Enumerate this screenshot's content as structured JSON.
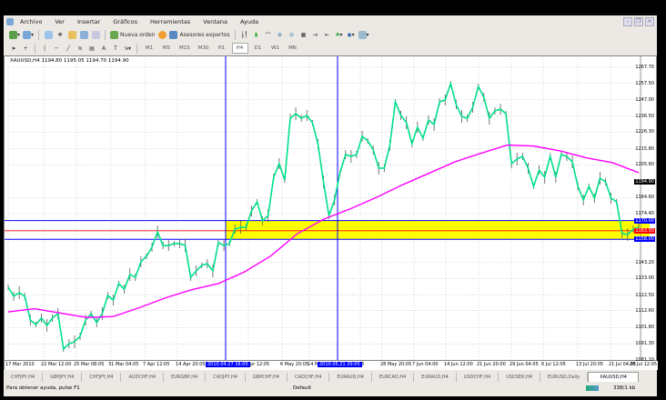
{
  "menu": [
    "Archivo",
    "Ver",
    "Insertar",
    "Gráficos",
    "Herramientas",
    "Ventana",
    "Ayuda"
  ],
  "toolbar": {
    "new_order": "Nueva orden",
    "experts": "Asesores expertos",
    "timeframes": [
      "M1",
      "M5",
      "M15",
      "M30",
      "H1",
      "H4",
      "D1",
      "W1",
      "MN"
    ],
    "active_timeframe": "H4"
  },
  "chart": {
    "header": "XAUUSD,H4  1194.80 1195.05 1194.70 1194.90",
    "colors": {
      "price": "#00e08a",
      "ma": "#ff00ff",
      "levels": "#0000ff",
      "mid_level": "#ff0000",
      "zone": "#ffff00",
      "bars": "#555555"
    }
  },
  "chart_data": {
    "type": "line",
    "symbol": "XAUUSD,H4",
    "ylim": [
      1081.1,
      1267.7
    ],
    "y_ticks": [
      "1267.70",
      "1257.50",
      "1247.00",
      "1236.50",
      "1226.30",
      "1215.80",
      "1205.60",
      "1184.60",
      "1174.40",
      "1143.20",
      "1133.00",
      "1122.50",
      "1112.60",
      "1101.80",
      "1091.30",
      "1081.10"
    ],
    "current_price": "1194.90",
    "levels": {
      "upper": "1170.00",
      "middle": "1163.50",
      "lower": "1158.00"
    },
    "x_ticks": [
      "17 Mar 2010",
      "22 Mar 12:00",
      "25 Mar 08:05",
      "31 Mar 04:05",
      "7 Apr 12:05",
      "14 Apr 20:05",
      "pr 12:05",
      "6 May 20:05",
      "14 May",
      "05",
      "28 May 20:05",
      "7 Jun 04:00",
      "14 Jun 12:00",
      "21 Jun 20:00",
      "29 Jun 04:05",
      "6 Jul 12:05",
      "13 Jul 20:05",
      "21 Jul 04:05",
      "28 Jul 12:05"
    ],
    "cursor_times": [
      "2010.04.27 16:05",
      "2010.05.21 20:05"
    ],
    "grid": true,
    "price": [
      1127.5,
      1121.7,
      1124.0,
      1121.7,
      1106.6,
      1103.7,
      1107.8,
      1103.1,
      1107.8,
      1110.7,
      1088.1,
      1091.5,
      1092.7,
      1096.2,
      1106.6,
      1110.7,
      1104.9,
      1110.7,
      1122.2,
      1119.3,
      1129.8,
      1126.3,
      1135.6,
      1133.8,
      1143.7,
      1147.2,
      1153.0,
      1162.8,
      1154.1,
      1154.1,
      1155.3,
      1155.3,
      1154.1,
      1133.8,
      1137.9,
      1141.4,
      1142.5,
      1137.9,
      1155.9,
      1154.1,
      1155.3,
      1164.5,
      1165.7,
      1165.7,
      1176.1,
      1181.9,
      1169.8,
      1173.2,
      1197.6,
      1206.3,
      1195.8,
      1235.2,
      1238.1,
      1235.2,
      1237.0,
      1232.4,
      1219.0,
      1194.7,
      1173.2,
      1183.1,
      1200.5,
      1212.1,
      1210.9,
      1212.1,
      1223.7,
      1220.8,
      1215.0,
      1203.4,
      1203.4,
      1217.9,
      1245.7,
      1237.0,
      1232.4,
      1219.0,
      1229.5,
      1222.5,
      1234.1,
      1231.2,
      1245.7,
      1246.8,
      1257.3,
      1243.9,
      1236.4,
      1235.2,
      1242.2,
      1255.5,
      1248.6,
      1235.2,
      1239.9,
      1241.0,
      1238.1,
      1206.3,
      1209.2,
      1210.9,
      1203.4,
      1191.8,
      1202.2,
      1197.6,
      1210.9,
      1197.6,
      1212.1,
      1210.9,
      1207.4,
      1191.8,
      1183.1,
      1191.8,
      1184.3,
      1197.0,
      1194.7,
      1184.3,
      1181.9,
      1161.7,
      1161.1,
      1164.5,
      1165.7
    ],
    "moving_average": [
      1111.8,
      1113.8,
      1111.0,
      1108.2,
      1108.8,
      1114.5,
      1120.8,
      1126.0,
      1129.8,
      1137.3,
      1147.5,
      1161.5,
      1170.8,
      1177.3,
      1184.6,
      1192.7,
      1200.0,
      1207.4,
      1212.9,
      1218.1,
      1217.5,
      1214.4,
      1210.0,
      1206.9,
      1200.5
    ]
  },
  "tabs": [
    "CHFJPY,H4",
    "GBPJPY,H4",
    "CHFJPY,H4",
    "AUDCHF,H4",
    "EURGBP,H4",
    "CADJPY,H4",
    "GBPCHF,H4",
    "CADCHF,H4",
    "EURAUD,H4",
    "EURCAD,H4",
    "EURAUD,H4",
    "USDCHF,H4",
    "USDSEK,H4",
    "EURUSD,Daily",
    "XAUUSD,H4"
  ],
  "active_tab": "XAUUSD,H4",
  "status": {
    "help": "Para obtener ayuda, pulse F1",
    "profile": "Default",
    "traffic": "338/1 kb"
  }
}
